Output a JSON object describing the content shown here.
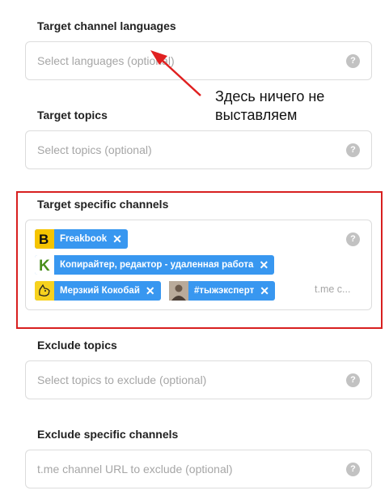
{
  "sections": {
    "languages": {
      "label": "Target channel languages",
      "placeholder": "Select languages (optional)"
    },
    "topics": {
      "label": "Target topics",
      "placeholder": "Select topics (optional)"
    },
    "specific": {
      "label": "Target specific channels",
      "tags": [
        {
          "label": "Freakbook",
          "icon": "freakbook-logo"
        },
        {
          "label": "Копирайтер, редактор - удаленная работа",
          "icon": "k-logo"
        },
        {
          "label": "Мерзкий Кокобай",
          "icon": "dog-logo"
        },
        {
          "label": "#тыжэксперт",
          "icon": "person-photo"
        }
      ],
      "input_placeholder": "t.me c..."
    },
    "exclude_topics": {
      "label": "Exclude topics",
      "placeholder": "Select topics to exclude (optional)"
    },
    "exclude_channels": {
      "label": "Exclude specific channels",
      "placeholder": "t.me channel URL to exclude (optional)"
    }
  },
  "help_glyph": "?",
  "remove_glyph": "✕",
  "annotation": {
    "line1": "Здесь ничего не",
    "line2": "выставляем"
  },
  "colors": {
    "tag": "#3897f0",
    "highlight_box": "#d82020",
    "arrow": "#e02020"
  }
}
